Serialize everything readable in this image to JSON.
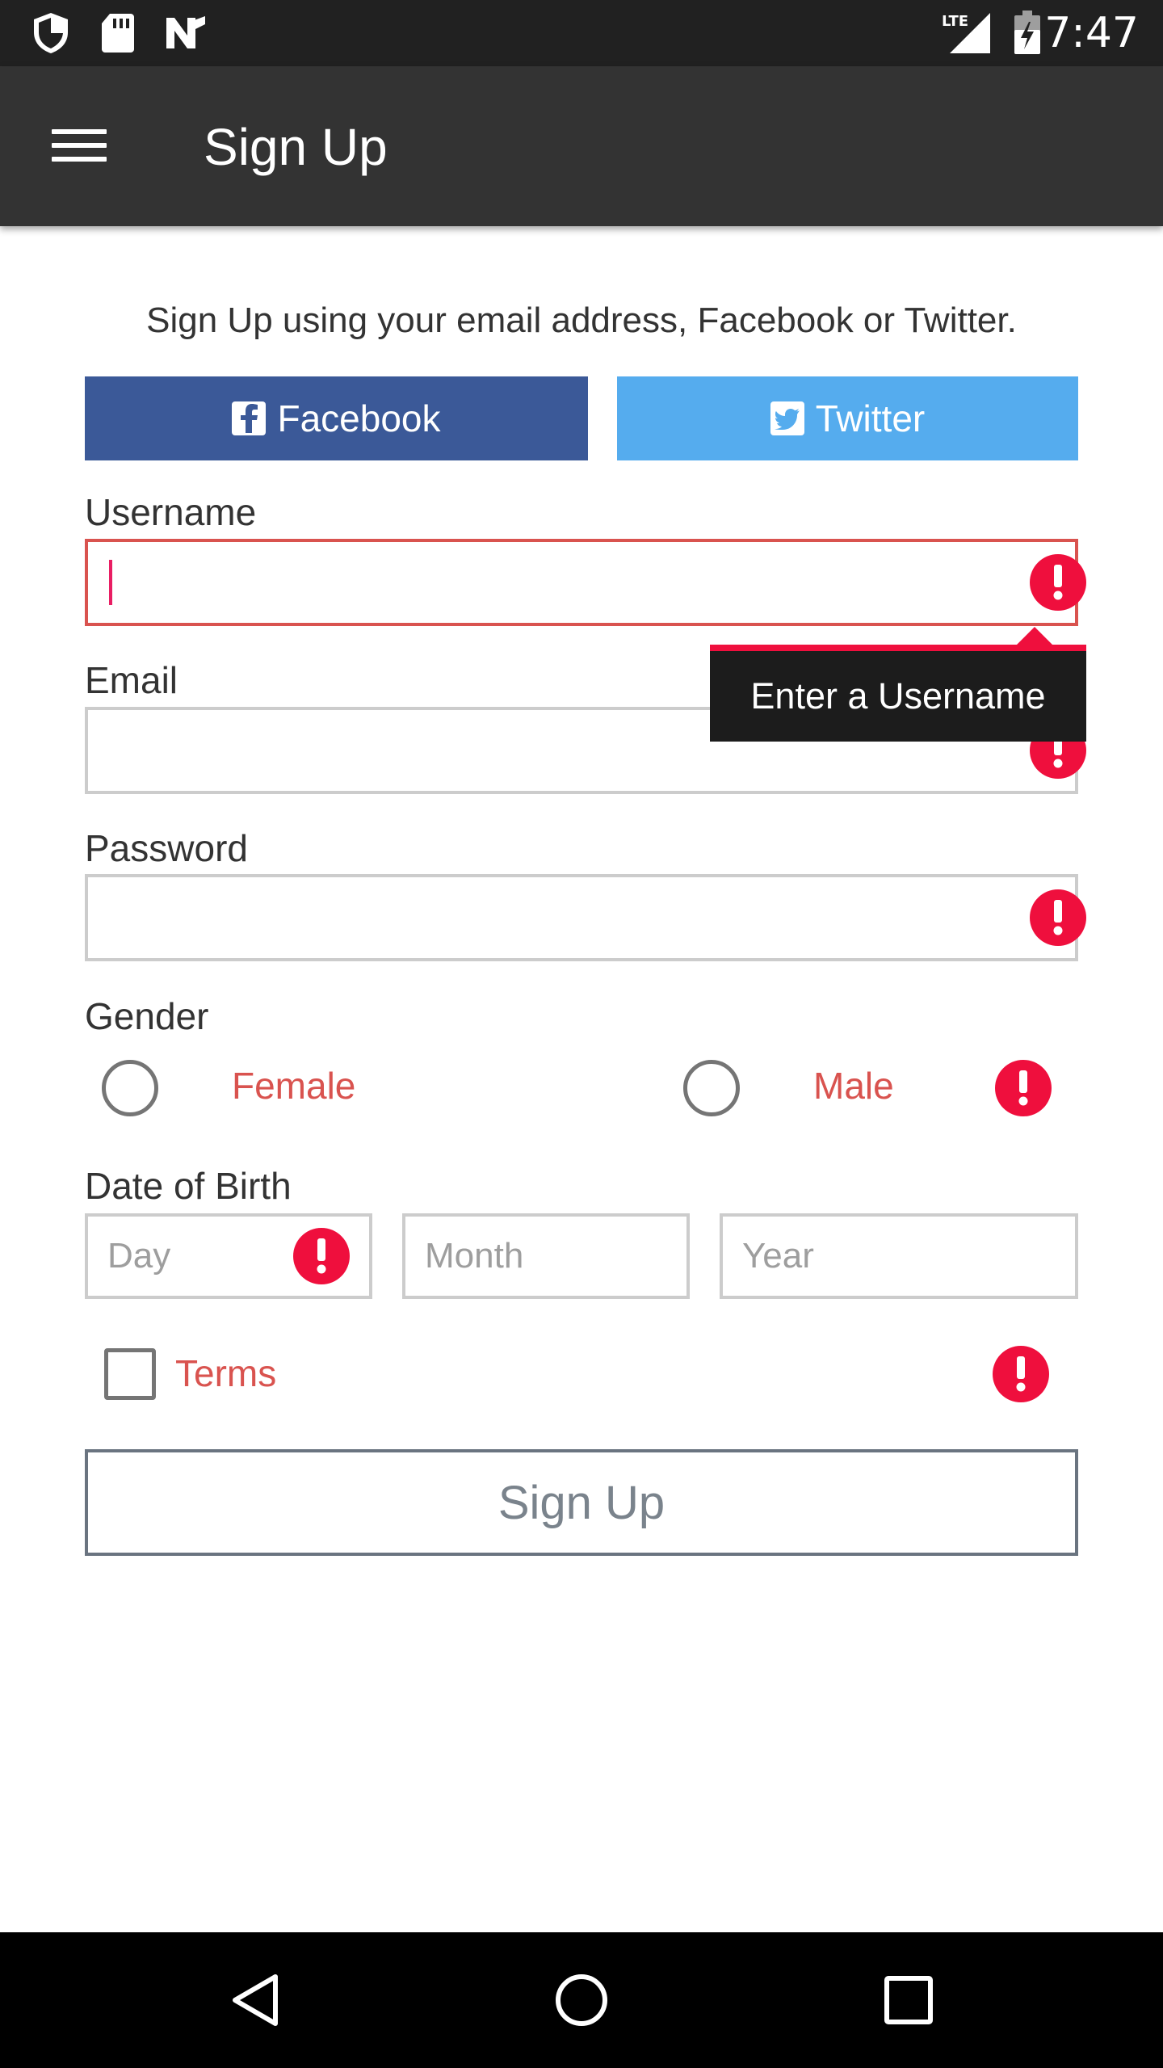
{
  "status_bar": {
    "time": "7:47",
    "network": "LTE",
    "left_icons": [
      "shield-icon",
      "sd-card-icon",
      "n-logo-icon"
    ],
    "right_icons": [
      "lte-signal-icon",
      "battery-icon"
    ]
  },
  "app_bar": {
    "title": "Sign Up",
    "menu_icon": "hamburger-menu-icon"
  },
  "intro_text": "Sign Up using your email address, Facebook or Twitter.",
  "social": {
    "facebook_label": "Facebook",
    "twitter_label": "Twitter",
    "facebook_color": "#3b5998",
    "twitter_color": "#55acee"
  },
  "form": {
    "username_label": "Username",
    "username_value": "",
    "username_tooltip": "Enter a Username",
    "email_label": "Email",
    "email_value": "",
    "password_label": "Password",
    "password_value": "",
    "gender_label": "Gender",
    "gender_options": [
      "Female",
      "Male"
    ],
    "dob_label": "Date of Birth",
    "dob_day_placeholder": "Day",
    "dob_month_placeholder": "Month",
    "dob_year_placeholder": "Year",
    "terms_label": "Terms",
    "submit_label": "Sign Up"
  },
  "colors": {
    "error": "#ef0f3d",
    "error_text": "#d9534f",
    "app_bar": "#333333",
    "status_bar": "#212121"
  },
  "nav_bar": {
    "buttons": [
      "back-icon",
      "home-icon",
      "recents-icon"
    ]
  }
}
